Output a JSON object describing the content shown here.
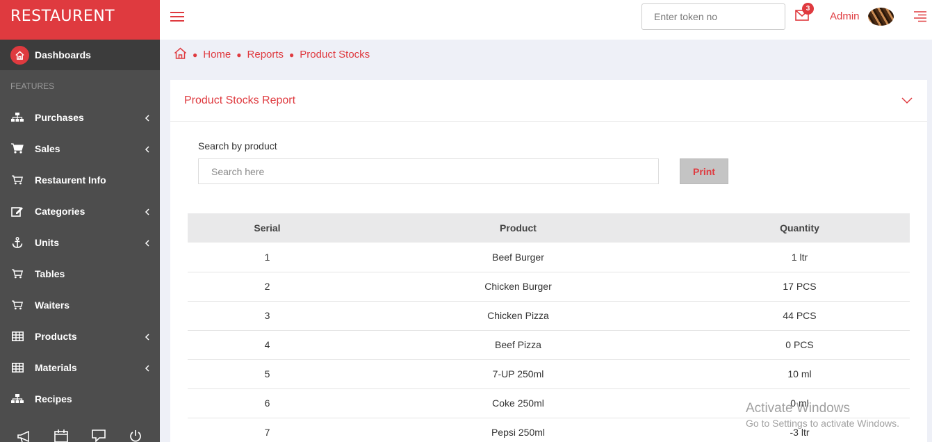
{
  "brand": "RESTAURENT",
  "sidebar": {
    "dashboard": "Dashboards",
    "section": "FEATURES",
    "items": [
      {
        "label": "Purchases",
        "icon": "sitemap-icon",
        "has_submenu": true
      },
      {
        "label": "Sales",
        "icon": "cart-icon",
        "has_submenu": true
      },
      {
        "label": "Restaurent Info",
        "icon": "cart-icon",
        "has_submenu": false
      },
      {
        "label": "Categories",
        "icon": "edit-icon",
        "has_submenu": true
      },
      {
        "label": "Units",
        "icon": "anchor-icon",
        "has_submenu": true
      },
      {
        "label": "Tables",
        "icon": "cart-icon",
        "has_submenu": false
      },
      {
        "label": "Waiters",
        "icon": "cart-icon",
        "has_submenu": false
      },
      {
        "label": "Products",
        "icon": "table-icon",
        "has_submenu": true
      },
      {
        "label": "Materials",
        "icon": "table-icon",
        "has_submenu": true
      },
      {
        "label": "Recipes",
        "icon": "sitemap-icon",
        "has_submenu": false
      }
    ],
    "footer_icons": [
      "megaphone-icon",
      "calendar-icon",
      "chat-icon",
      "power-icon"
    ]
  },
  "topbar": {
    "token_placeholder": "Enter token no",
    "notification_count": "3",
    "user": "Admin"
  },
  "breadcrumb": [
    "Home",
    "Reports",
    "Product Stocks"
  ],
  "card": {
    "title": "Product Stocks Report",
    "search_label": "Search by product",
    "search_placeholder": "Search here",
    "print_label": "Print"
  },
  "table": {
    "headers": [
      "Serial",
      "Product",
      "Quantity"
    ],
    "rows": [
      [
        "1",
        "Beef Burger",
        "1 ltr"
      ],
      [
        "2",
        "Chicken Burger",
        "17 PCS"
      ],
      [
        "3",
        "Chicken Pizza",
        "44 PCS"
      ],
      [
        "4",
        "Beef Pizza",
        "0 PCS"
      ],
      [
        "5",
        "7-UP 250ml",
        "10 ml"
      ],
      [
        "6",
        "Coke 250ml",
        "0 ml"
      ],
      [
        "7",
        "Pepsi 250ml",
        "-3 ltr"
      ]
    ]
  },
  "watermark": {
    "line1": "Activate Windows",
    "line2": "Go to Settings to activate Windows."
  },
  "colors": {
    "accent": "#df3a3f",
    "sidebar": "#4d4d4d",
    "background": "#eef0f7"
  }
}
